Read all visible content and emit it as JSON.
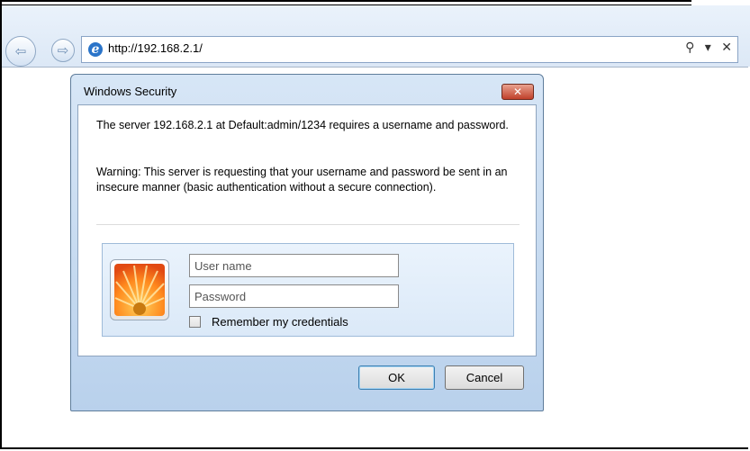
{
  "browser": {
    "url": "http://192.168.2.1/",
    "back_icon": "back-arrow-icon",
    "forward_icon": "forward-arrow-icon",
    "search_symbol": "⚲",
    "dropdown_symbol": "▾",
    "close_symbol": "✕"
  },
  "dialog": {
    "title": "Windows Security",
    "close_glyph": "✕",
    "message": "The server 192.168.2.1 at Default:admin/1234 requires a username and password.",
    "warning": "Warning: This server is requesting that your username and password be sent in an insecure manner (basic authentication without a secure connection).",
    "username_placeholder": "User name",
    "password_placeholder": "Password",
    "remember_label": "Remember my credentials",
    "ok_label": "OK",
    "cancel_label": "Cancel"
  }
}
